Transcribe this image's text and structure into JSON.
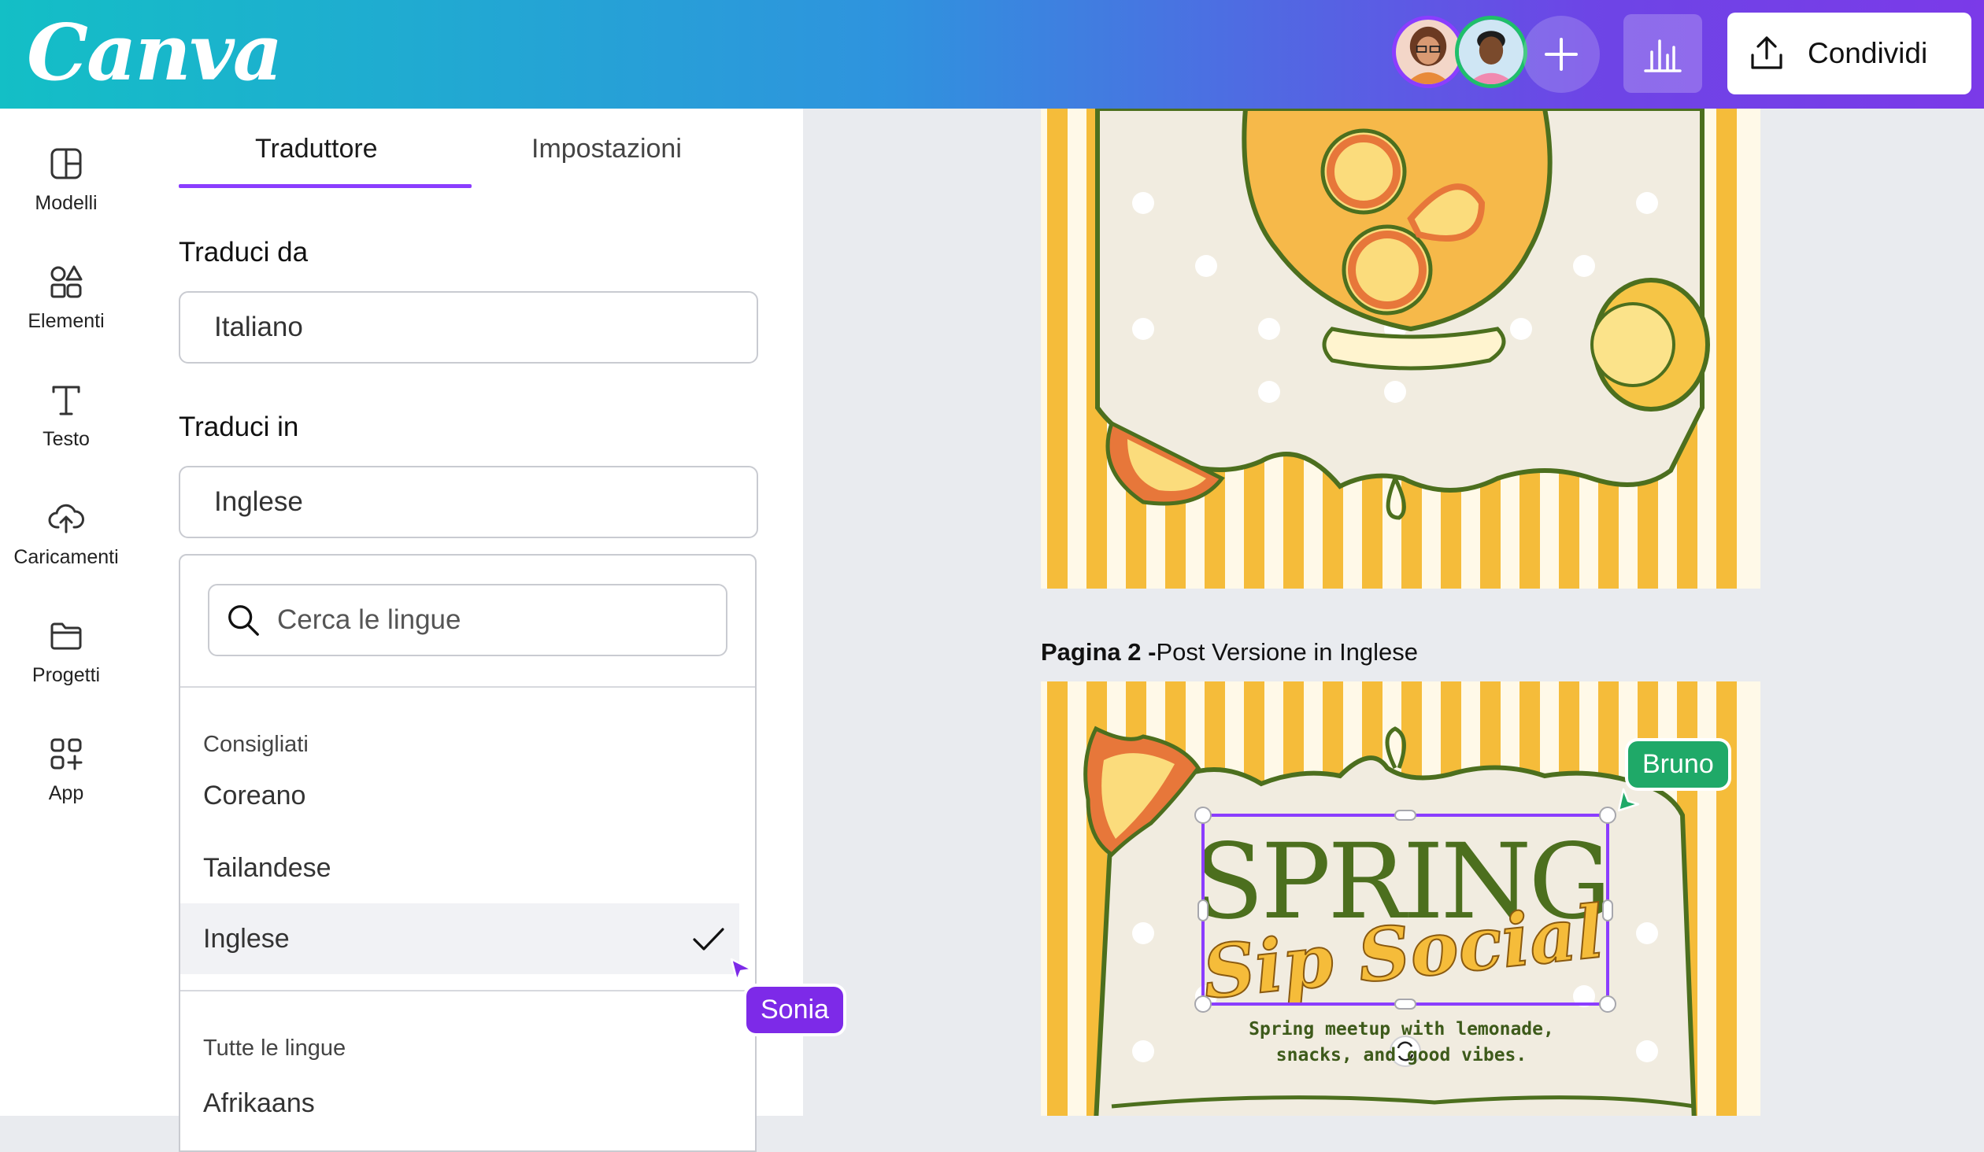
{
  "app": {
    "logo": "Canva"
  },
  "header": {
    "collaborators": [
      {
        "name": "collaborator-1",
        "ring_color": "#8b3dff"
      },
      {
        "name": "collaborator-2",
        "ring_color": "#1fbf6a"
      }
    ],
    "share_label": "Condividi"
  },
  "rail": {
    "items": [
      {
        "label": "Modelli",
        "icon": "templates-icon"
      },
      {
        "label": "Elementi",
        "icon": "elements-icon"
      },
      {
        "label": "Testo",
        "icon": "text-icon"
      },
      {
        "label": "Caricamenti",
        "icon": "upload-icon"
      },
      {
        "label": "Progetti",
        "icon": "folder-icon"
      },
      {
        "label": "App",
        "icon": "apps-icon"
      }
    ]
  },
  "panel": {
    "tabs": [
      {
        "label": "Traduttore",
        "active": true
      },
      {
        "label": "Impostazioni",
        "active": false
      }
    ],
    "from_label": "Traduci da",
    "from_value": "Italiano",
    "to_label": "Traduci in",
    "to_value": "Inglese",
    "search_placeholder": "Cerca le lingue",
    "recommended_heading": "Consigliati",
    "recommended": [
      {
        "label": "Coreano",
        "selected": false
      },
      {
        "label": "Tailandese",
        "selected": false
      },
      {
        "label": "Inglese",
        "selected": true
      }
    ],
    "all_heading": "Tutte le lingue",
    "all_languages": [
      "Afrikaans"
    ]
  },
  "cursors": {
    "sonia": {
      "label": "Sonia",
      "color": "#7d2ae8"
    },
    "bruno": {
      "label": "Bruno",
      "color": "#1fa968"
    }
  },
  "canvas": {
    "page2_title_bold": "Pagina 2 -",
    "page2_title_rest": "Post Versione in Inglese",
    "design": {
      "headline": "SPRING",
      "script": "Sip Social",
      "body_line1": "Spring meetup with lemonade,",
      "body_line2": "snacks, and good vibes."
    }
  },
  "colors": {
    "accent": "#8b3dff",
    "stripe_yellow": "#f5bc3a",
    "leaf_green": "#4c6f1e",
    "orange": "#e7773a"
  }
}
